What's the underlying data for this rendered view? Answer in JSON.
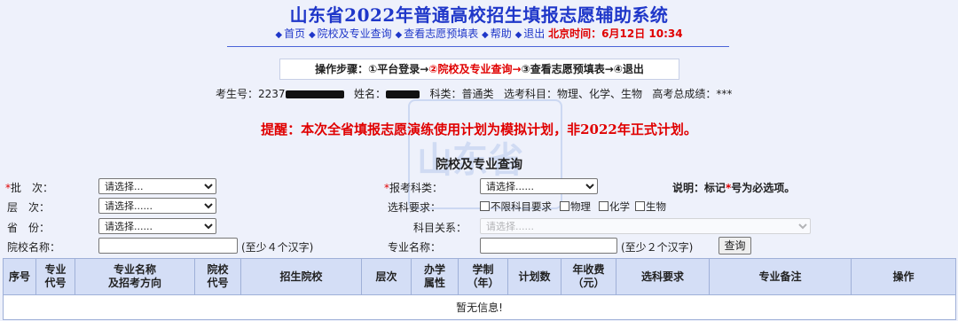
{
  "header": {
    "title": "山东省2022年普通高校招生填报志愿辅助系统",
    "nav": [
      "首页",
      "院校及专业查询",
      "查看志愿预填表",
      "帮助",
      "退出"
    ],
    "time_label": "北京时间：6月12日 10:34"
  },
  "steps": {
    "prefix": "操作步骤：",
    "items": [
      "①平台登录→",
      "②院校及专业查询→",
      "③查看志愿预填表→",
      "④退出"
    ]
  },
  "candidate": {
    "exam_no_label": "考生号：2237",
    "name_label": "姓名：",
    "category": "科类：普通类",
    "subjects": "选考科目：物理、化学、生物",
    "score": "高考总成绩：***"
  },
  "notice": "提醒：本次全省填报志愿演练使用计划为模拟计划，非2022年正式计划。",
  "section_title": "院校及专业查询",
  "form": {
    "batch_label": "批　次：",
    "batch_value": "请选择...",
    "level_label": "层　次：",
    "level_value": "请选择......",
    "province_label": "省　份：",
    "province_value": "请选择......",
    "school_label": "院校名称：",
    "school_hint": "(至少４个汉字)",
    "subject_category_label": "报考科类：",
    "subject_category_value": "请选择......",
    "subject_req_label": "选科要求：",
    "subject_options": [
      "不限科目要求",
      "物理",
      "化学",
      "生物"
    ],
    "subject_rel_label": "科目关系：",
    "subject_rel_value": "请选择......",
    "major_label": "专业名称：",
    "major_hint": "(至少２个汉字)",
    "query_button": "查询",
    "required_note_a": "说明：标记",
    "required_note_star": "*",
    "required_note_b": "号为必选项。"
  },
  "table": {
    "headers": [
      "序号",
      "专业\n代号",
      "专业名称\n及招考方向",
      "院校\n代号",
      "招生院校",
      "层次",
      "办学\n属性",
      "学制\n（年）",
      "计划数",
      "年收费\n（元）",
      "选科要求",
      "专业备注",
      "操作"
    ],
    "empty_text": "暂无信息!"
  },
  "watermark": "山东省"
}
